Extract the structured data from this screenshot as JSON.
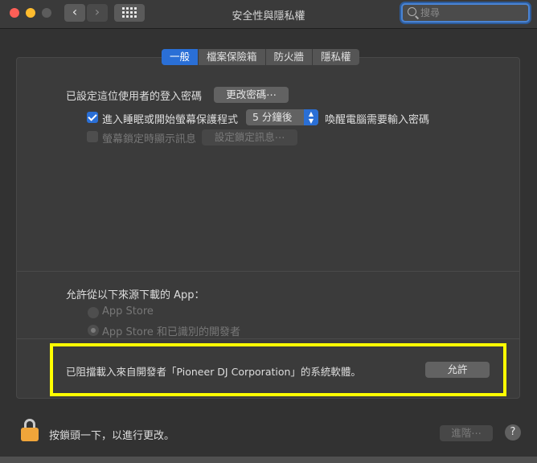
{
  "window": {
    "title": "安全性與隱私權",
    "nav_back": "‹",
    "nav_forward": "›"
  },
  "search": {
    "placeholder": "搜尋"
  },
  "tabs": [
    {
      "label": "一般",
      "active": true
    },
    {
      "label": "檔案保險箱",
      "active": false
    },
    {
      "label": "防火牆",
      "active": false
    },
    {
      "label": "隱私權",
      "active": false
    }
  ],
  "general": {
    "login_password_text": "已設定這位使用者的登入密碼",
    "change_password_button": "更改密碼⋯",
    "require_password": {
      "checked": true,
      "label_before": "進入睡眠或開始螢幕保護程式",
      "select_value": "5 分鐘後",
      "label_after": "喚醒電腦需要輸入密碼"
    },
    "show_message": {
      "checked": false,
      "label": "螢幕鎖定時顯示訊息",
      "button": "設定鎖定訊息⋯"
    }
  },
  "allow_apps": {
    "heading": "允許從以下來源下載的 App：",
    "options": [
      {
        "label": "App Store",
        "selected": false
      },
      {
        "label": "App Store 和已識別的開發者",
        "selected": true
      }
    ]
  },
  "blocked": {
    "message": "已阻擋載入來自開發者「Pioneer DJ Corporation」的系統軟體。",
    "allow_button": "允許"
  },
  "footer": {
    "lock_text": "按鎖頭一下，以進行更改。",
    "advanced_button": "進階⋯",
    "help_label": "?"
  },
  "colors": {
    "accent": "#2a6fd6",
    "highlight": "#ffff00",
    "lock": "#f0a53a"
  }
}
